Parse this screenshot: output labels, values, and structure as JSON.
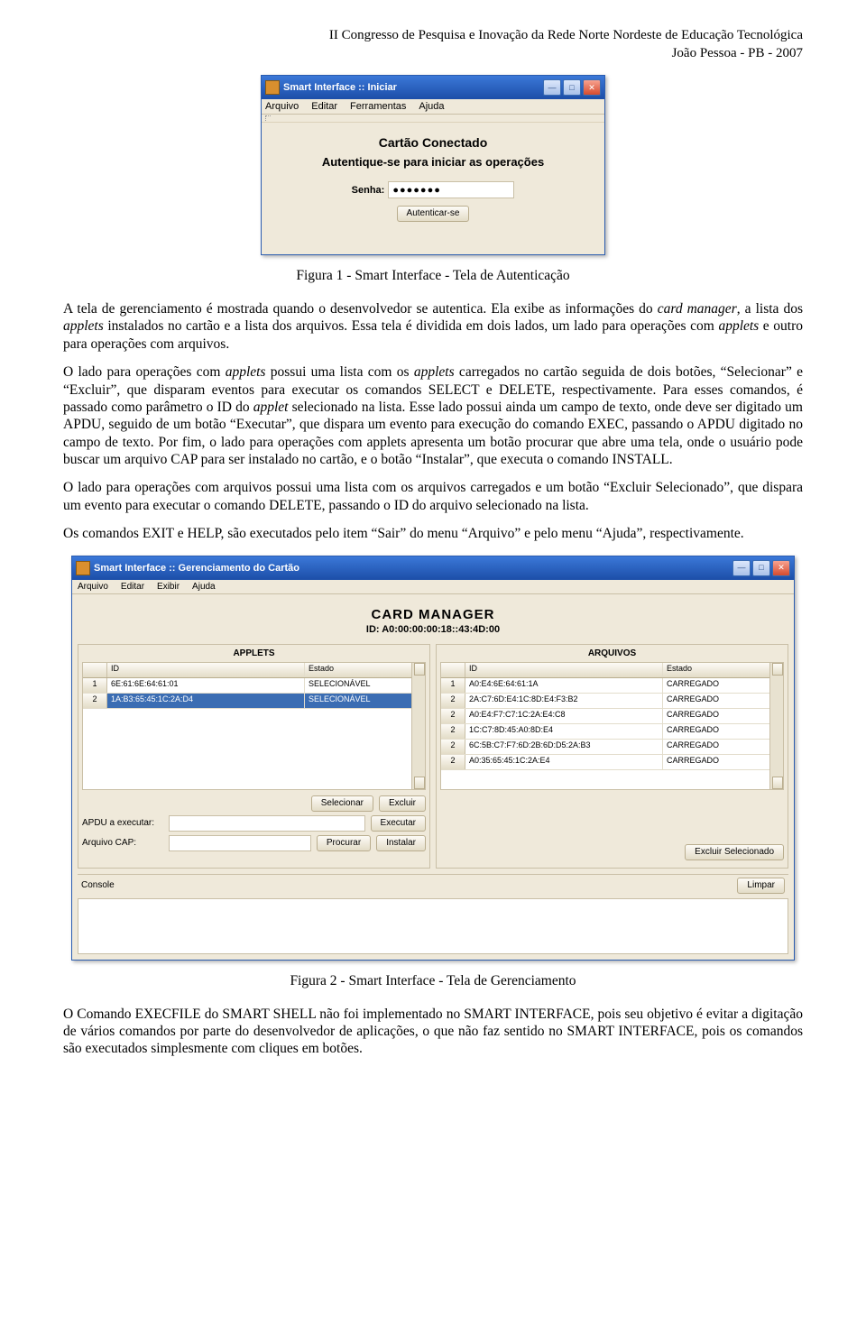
{
  "header": {
    "line1": "II Congresso de Pesquisa e Inovação da Rede Norte Nordeste de Educação Tecnológica",
    "line2": "João Pessoa - PB - 2007"
  },
  "fig1": {
    "caption": "Figura 1 - Smart Interface - Tela de Autenticação",
    "titlebar": "Smart Interface :: Iniciar",
    "menu": [
      "Arquivo",
      "Editar",
      "Ferramentas",
      "Ajuda"
    ],
    "heading1": "Cartão Conectado",
    "heading2": "Autentique-se para iniciar as operações",
    "pwd_label": "Senha:",
    "pwd_value": "●●●●●●●",
    "btn_auth": "Autenticar-se"
  },
  "paras": {
    "p1": "A tela de gerenciamento é mostrada quando o desenvolvedor se autentica. Ela exibe as informações do card manager, a lista dos applets instalados no cartão e a lista dos arquivos. Essa tela é dividida em dois lados, um lado para operações com applets e outro para operações com arquivos.",
    "p2": "O lado para operações com applets possui uma lista com os applets carregados no cartão seguida de dois botões, “Selecionar” e “Excluir”, que disparam eventos para executar os comandos SELECT e DELETE, respectivamente. Para esses comandos, é passado como parâmetro o ID do applet selecionado na lista. Esse lado possui ainda um campo de texto, onde deve ser digitado um APDU, seguido de um botão “Executar”, que dispara um evento para execução do comando EXEC, passando o APDU digitado no campo de texto. Por fim, o lado para operações com applets apresenta um botão procurar que abre uma tela, onde o usuário pode buscar um arquivo CAP para ser instalado no cartão, e o botão “Instalar”, que executa o comando INSTALL.",
    "p3": "O lado para operações com arquivos possui uma lista com os arquivos carregados e um botão “Excluir Selecionado”, que dispara um evento para executar o comando DELETE, passando o ID do arquivo selecionado na lista.",
    "p4": "Os comandos EXIT e HELP, são executados pelo item “Sair” do menu “Arquivo” e pelo menu “Ajuda”, respectivamente."
  },
  "fig2": {
    "caption": "Figura 2 - Smart Interface - Tela de Gerenciamento",
    "titlebar": "Smart Interface :: Gerenciamento do Cartão",
    "menu": [
      "Arquivo",
      "Editar",
      "Exibir",
      "Ajuda"
    ],
    "cm_title": "CARD MANAGER",
    "cm_id": "ID: A0:00:00:00:18::43:4D:00",
    "applets_title": "APPLETS",
    "arquivos_title": "ARQUIVOS",
    "col_id": "ID",
    "col_estado": "Estado",
    "applets": [
      {
        "n": "1",
        "id": "6E:61:6E:64:61:01",
        "estado": "SELECIONÁVEL"
      },
      {
        "n": "2",
        "id": "1A:B3:65:45:1C:2A:D4",
        "estado": "SELECIONÁVEL"
      }
    ],
    "arquivos": [
      {
        "n": "1",
        "id": "A0:E4:6E:64:61:1A",
        "estado": "CARREGADO"
      },
      {
        "n": "2",
        "id": "2A:C7:6D:E4:1C:8D:E4:F3:B2",
        "estado": "CARREGADO"
      },
      {
        "n": "2",
        "id": "A0:E4:F7:C7:1C:2A:E4:C8",
        "estado": "CARREGADO"
      },
      {
        "n": "2",
        "id": "1C:C7:8D:45:A0:8D:E4",
        "estado": "CARREGADO"
      },
      {
        "n": "2",
        "id": "6C:5B:C7:F7:6D:2B:6D:D5:2A:B3",
        "estado": "CARREGADO"
      },
      {
        "n": "2",
        "id": "A0:35:65:45:1C:2A:E4",
        "estado": "CARREGADO"
      }
    ],
    "btn_selecionar": "Selecionar",
    "btn_excluir": "Excluir",
    "lbl_apdu": "APDU a executar:",
    "btn_executar": "Executar",
    "lbl_cap": "Arquivo CAP:",
    "btn_procurar": "Procurar",
    "btn_instalar": "Instalar",
    "btn_excluir_sel": "Excluir Selecionado",
    "lbl_console": "Console",
    "btn_limpar": "Limpar"
  },
  "final_para": "O Comando EXECFILE do SMART SHELL não foi implementado no SMART INTERFACE, pois seu objetivo é evitar a digitação de vários comandos por parte do desenvolvedor de aplicações, o que não faz sentido no SMART INTERFACE, pois os comandos são executados simplesmente com cliques em botões."
}
